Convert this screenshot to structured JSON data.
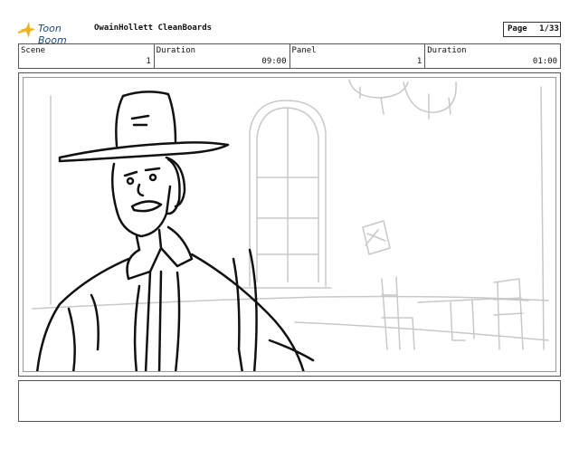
{
  "header": {
    "logo_text": "Toon Boom",
    "project_title": "OwainHollett CleanBoards",
    "page_label": "Page",
    "page_number": "1/33"
  },
  "info": {
    "scene_label": "Scene",
    "scene_value": "1",
    "scene_duration_label": "Duration",
    "scene_duration_value": "09:00",
    "panel_label": "Panel",
    "panel_value": "1",
    "panel_duration_label": "Duration",
    "panel_duration_value": "01:00"
  },
  "notes": {
    "text": ""
  },
  "colors": {
    "logo_star": "#f2b21b",
    "logo_text": "#1f4a7a",
    "background_sketch": "#c8c8c8"
  }
}
